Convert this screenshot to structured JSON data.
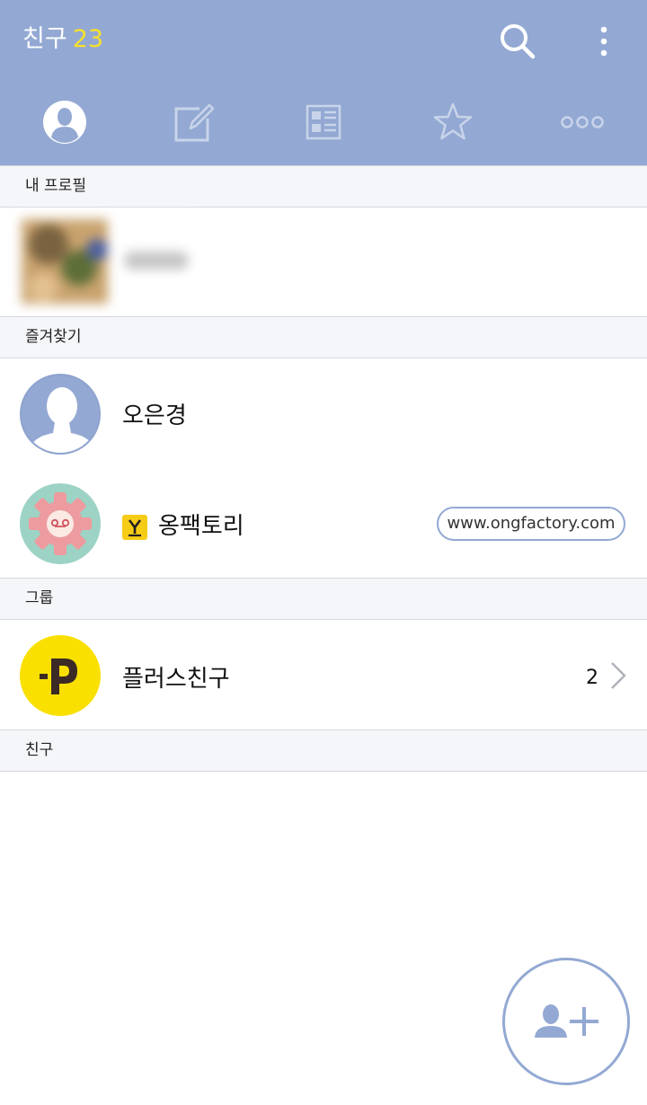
{
  "header": {
    "title": "친구",
    "count": "23",
    "search_icon": "search-icon",
    "menu_icon": "more-vertical-icon"
  },
  "tabs": [
    {
      "icon": "person-icon",
      "active": true
    },
    {
      "icon": "compose-icon",
      "active": false
    },
    {
      "icon": "news-icon",
      "active": false
    },
    {
      "icon": "star-icon",
      "active": false
    },
    {
      "icon": "more-horizontal-icon",
      "active": false
    }
  ],
  "sections": {
    "my_profile": "내 프로필",
    "favorites": "즐겨찾기",
    "groups": "그룹",
    "friends": "친구"
  },
  "favorites": [
    {
      "name": "오은경"
    },
    {
      "name": "옹팩토리",
      "badge": "Y",
      "link": "www.ongfactory.com"
    }
  ],
  "groups": [
    {
      "name": "플러스친구",
      "count": "2"
    }
  ],
  "colors": {
    "header_bg": "#93a9d3",
    "count_accent": "#f7e12b",
    "plus_yellow": "#f9e000"
  }
}
